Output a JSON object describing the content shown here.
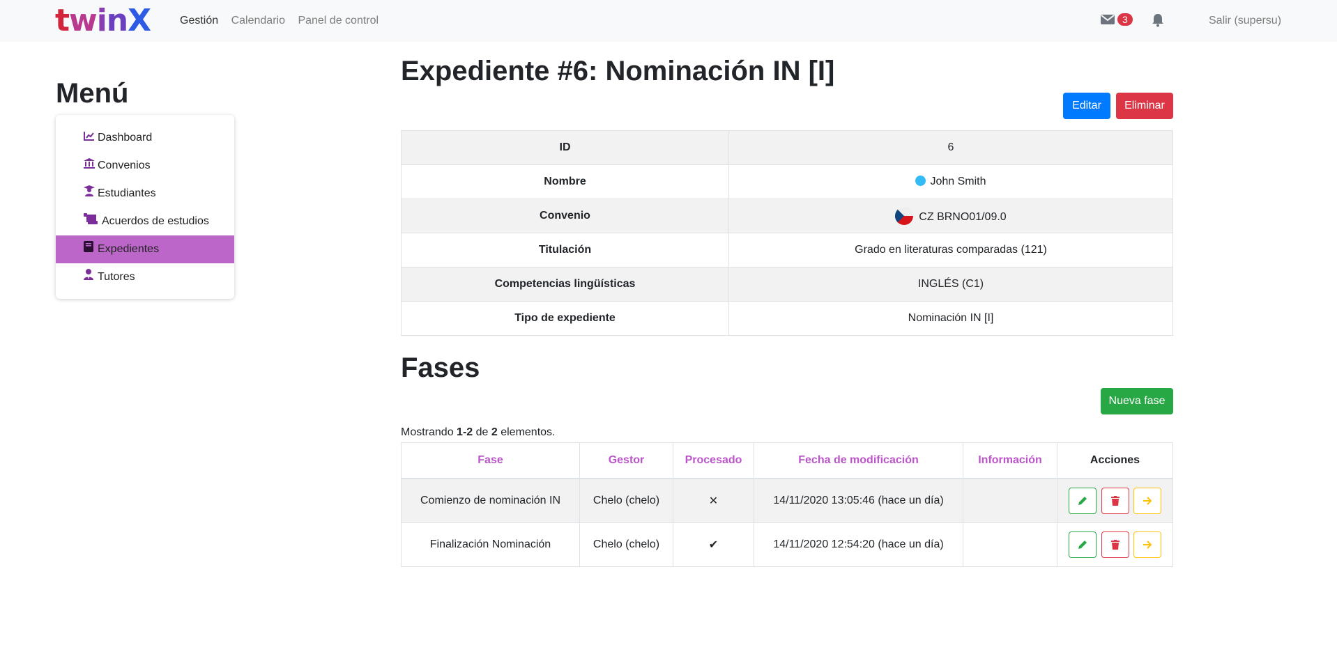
{
  "navbar": {
    "brand": {
      "t": "t",
      "w": "w",
      "i": "i",
      "n": "n",
      "x": "X"
    },
    "links": [
      "Gestión",
      "Calendario",
      "Panel de control"
    ],
    "mail_count": "3",
    "logout": "Salir (supersu)"
  },
  "sidebar": {
    "title": "Menú",
    "items": [
      {
        "label": "Dashboard",
        "icon": "chart-line-icon"
      },
      {
        "label": "Convenios",
        "icon": "university-icon"
      },
      {
        "label": "Estudiantes",
        "icon": "graduate-icon"
      },
      {
        "label": "Acuerdos de estudios",
        "icon": "scroll-icon"
      },
      {
        "label": "Expedientes",
        "icon": "book-icon",
        "active": true
      },
      {
        "label": "Tutores",
        "icon": "user-tie-icon"
      }
    ]
  },
  "page": {
    "title": "Expediente #6: Nominación IN [I]",
    "edit_label": "Editar",
    "delete_label": "Eliminar"
  },
  "details": [
    {
      "key": "ID",
      "value": "6"
    },
    {
      "key": "Nombre",
      "value": "John Smith"
    },
    {
      "key": "Convenio",
      "value": "CZ BRNO01/09.0"
    },
    {
      "key": "Titulación",
      "value": "Grado en literaturas comparadas (121)"
    },
    {
      "key": "Competencias lingüísticas",
      "value": "INGLÉS (C1)"
    },
    {
      "key": "Tipo de expediente",
      "value": "Nominación IN [I]"
    }
  ],
  "phases": {
    "title": "Fases",
    "new_label": "Nueva fase",
    "summary": {
      "prefix": "Mostrando ",
      "range": "1-2",
      "mid": " de ",
      "total": "2",
      "suffix": " elementos."
    },
    "headers": [
      "Fase",
      "Gestor",
      "Procesado",
      "Fecha de modificación",
      "Información",
      "Acciones"
    ],
    "rows": [
      {
        "fase": "Comienzo de nominación IN",
        "gestor": "Chelo (chelo)",
        "procesado": "✕",
        "fecha": "14/11/2020 13:05:46 (hace un día)",
        "info": ""
      },
      {
        "fase": "Finalización Nominación",
        "gestor": "Chelo (chelo)",
        "procesado": "✔",
        "fecha": "14/11/2020 12:54:20 (hace un día)",
        "info": ""
      }
    ]
  },
  "colors": {
    "accent": "#bb66c8",
    "primary": "#007bff",
    "danger": "#dc3545",
    "success": "#28a745",
    "warning": "#ffc107"
  }
}
